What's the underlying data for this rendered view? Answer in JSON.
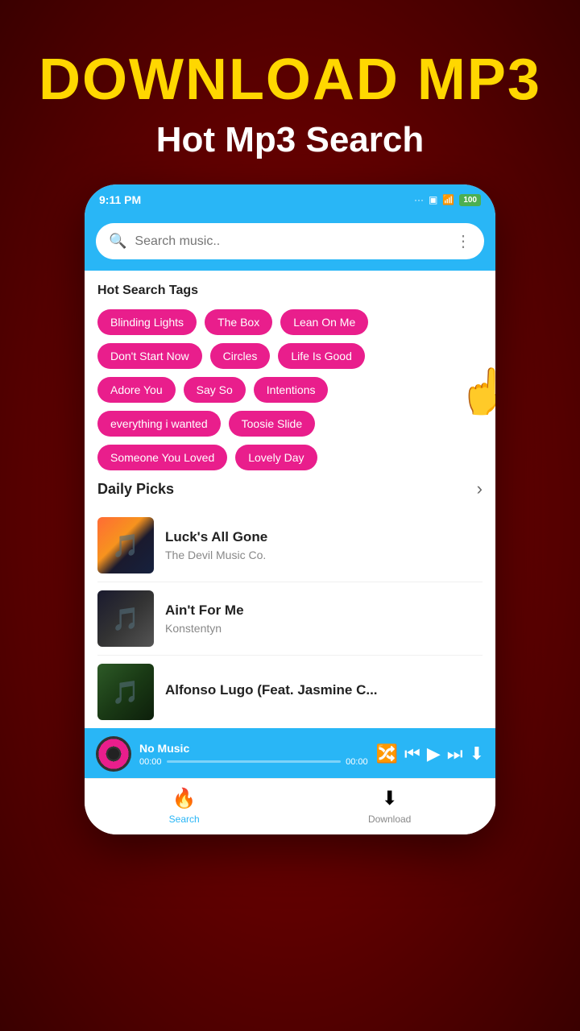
{
  "hero": {
    "title": "DOWNLOAD MP3",
    "subtitle": "Hot Mp3 Search"
  },
  "statusBar": {
    "time": "9:11 PM",
    "dots": "...",
    "battery": "100"
  },
  "searchBar": {
    "placeholder": "Search music.."
  },
  "hotSearchSection": {
    "title": "Hot Search Tags",
    "tags": [
      "Blinding Lights",
      "The Box",
      "Lean On Me",
      "Don't Start Now",
      "Circles",
      "Life Is Good",
      "Adore You",
      "Say So",
      "Intentions",
      "everything i wanted",
      "Toosie Slide",
      "Someone You Loved",
      "Lovely Day"
    ]
  },
  "dailyPicks": {
    "title": "Daily Picks",
    "songs": [
      {
        "title": "Luck's All Gone",
        "artist": "The Devil Music Co."
      },
      {
        "title": "Ain't For Me",
        "artist": "Konstentyn"
      },
      {
        "title": "Alfonso Lugo (Feat. Jasmine C...",
        "artist": ""
      }
    ]
  },
  "player": {
    "songName": "No Music",
    "timeStart": "00:00",
    "timeEnd": "00:00"
  },
  "bottomNav": {
    "items": [
      {
        "label": "Search",
        "icon": "🔥",
        "active": true
      },
      {
        "label": "Download",
        "icon": "⬇",
        "active": false
      }
    ]
  }
}
